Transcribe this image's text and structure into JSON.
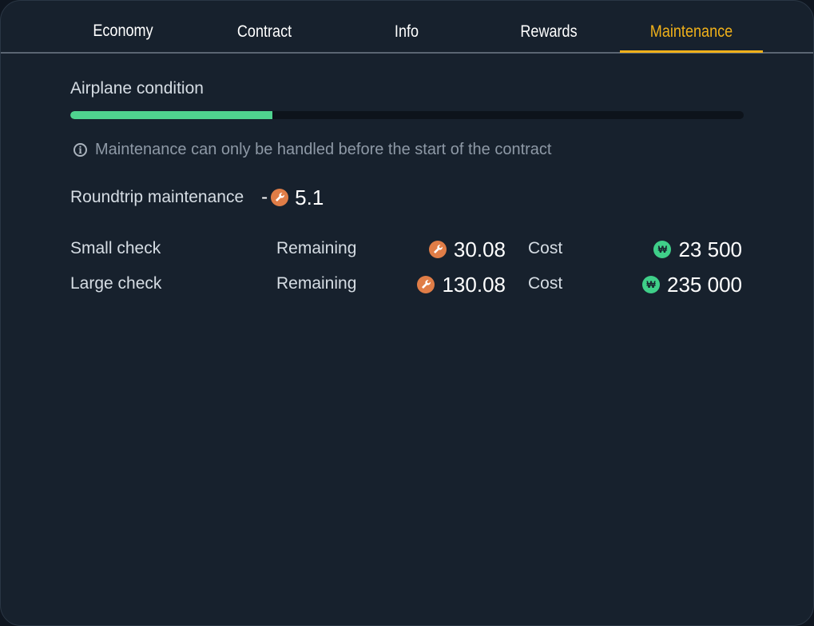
{
  "tabs": [
    {
      "label": "Economy",
      "active": false
    },
    {
      "label": "Contract",
      "active": false
    },
    {
      "label": "Info",
      "active": false
    },
    {
      "label": "Rewards",
      "active": false
    },
    {
      "label": "Maintenance",
      "active": true
    }
  ],
  "condition": {
    "label": "Airplane condition",
    "fill_fraction": 0.3
  },
  "info_text": "Maintenance can only be handled before the start of the contract",
  "roundtrip": {
    "label": "Roundtrip maintenance",
    "sign": "-",
    "value": "5.1",
    "icon": "wrench-icon"
  },
  "checks": [
    {
      "name": "Small check",
      "remaining_label": "Remaining",
      "remaining": "30.08",
      "cost_label": "Cost",
      "cost": "23 500"
    },
    {
      "name": "Large check",
      "remaining_label": "Remaining",
      "remaining": "130.08",
      "cost_label": "Cost",
      "cost": "235 000"
    }
  ],
  "colors": {
    "accent": "#f0b11a",
    "condition_bar": "#4fd38f",
    "maintenance_icon": "#e07d47",
    "currency_icon": "#3fcf89"
  },
  "currency_icon": "coin-icon"
}
